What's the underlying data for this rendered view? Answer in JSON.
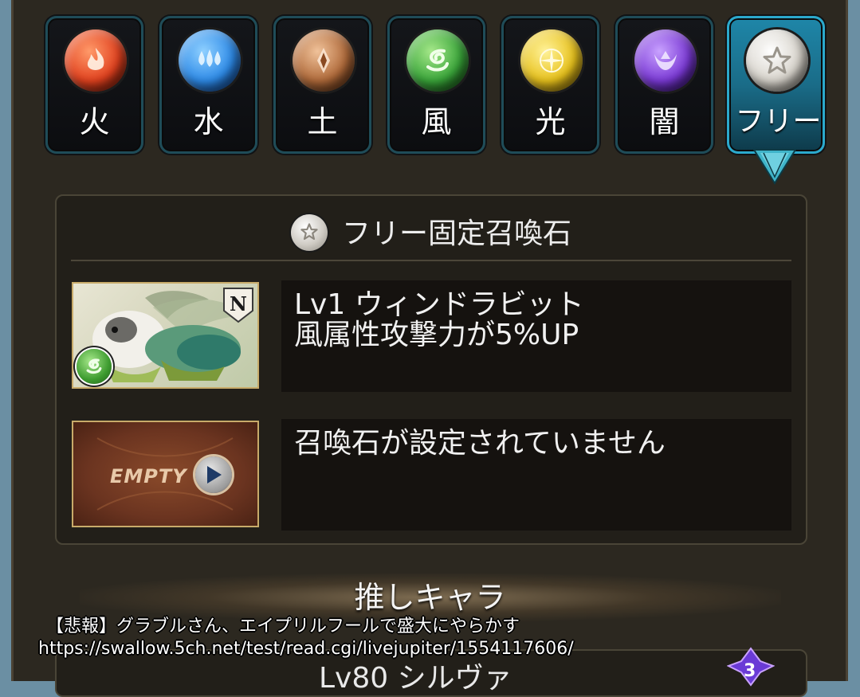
{
  "element_tabs": [
    {
      "label": "火",
      "icon": "fire-icon",
      "color": "#e2421f"
    },
    {
      "label": "水",
      "icon": "water-icon",
      "color": "#2e8be8"
    },
    {
      "label": "土",
      "icon": "earth-icon",
      "color": "#b06a3a"
    },
    {
      "label": "風",
      "icon": "wind-icon",
      "color": "#3aa63a"
    },
    {
      "label": "光",
      "icon": "light-icon",
      "color": "#e8c21c"
    },
    {
      "label": "闇",
      "icon": "dark-icon",
      "color": "#7b3ad6"
    },
    {
      "label": "フリー",
      "icon": "star-icon",
      "color": "#d8d4cc",
      "active": true
    }
  ],
  "panel": {
    "title": "フリー固定召喚石",
    "summons": [
      {
        "line1": "Lv1 ウィンドラビット",
        "line2": "風属性攻撃力が5%UP",
        "rarity": "N",
        "element_icon": "wind-icon"
      },
      {
        "line1": "召喚石が設定されていません",
        "empty_label": "EMPTY"
      }
    ]
  },
  "section": {
    "title": "推しキャラ",
    "lower_name": "Lv80 シルヴァ",
    "gem_number": "3"
  },
  "caption": {
    "line1": "【悲報】グラブルさん、エイプリルフールで盛大にやらかす",
    "line2": "https://swallow.5ch.net/test/read.cgi/livejupiter/1554117606/"
  },
  "colors": {
    "active_tab": "#1e86a8",
    "panel_bg": "#221f19",
    "frame_bg": "#2c2820",
    "accent_gold": "#c8ab6a"
  }
}
